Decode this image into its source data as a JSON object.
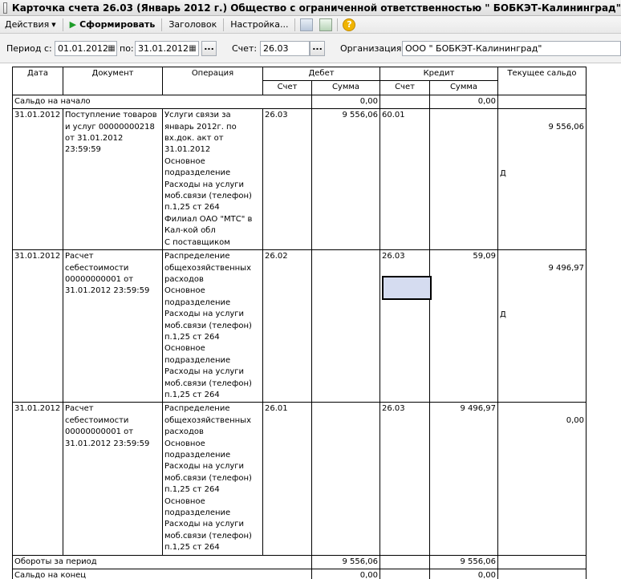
{
  "window": {
    "title": "Карточка счета 26.03 (Январь 2012 г.) Общество с ограниченной ответственностью \" БОБКЭТ-Калининград\""
  },
  "toolbar": {
    "actions_label": "Действия",
    "generate_label": "Сформировать",
    "header_label": "Заголовок",
    "settings_label": "Настройка..."
  },
  "params": {
    "period_from_label": "Период с:",
    "period_from": "01.01.2012",
    "period_to_label": "по:",
    "period_to": "31.01.2012",
    "account_label": "Счет:",
    "account": "26.03",
    "org_label": "Организация:",
    "org": "ООО \" БОБКЭТ-Калининград\"",
    "dots": "..."
  },
  "report": {
    "headers": {
      "date": "Дата",
      "document": "Документ",
      "operation": "Операция",
      "debit": "Дебет",
      "credit": "Кредит",
      "balance": "Текущее сальдо",
      "account": "Счет",
      "sum": "Сумма"
    },
    "opening": {
      "label": "Сальдо на начало",
      "debit_sum": "0,00",
      "credit_sum": "0,00"
    },
    "rows": [
      {
        "date": "31.01.2012",
        "document": "Поступление товаров\nи услуг 00000000218\nот 31.01.2012 23:59:59",
        "operation": "Услуги связи за\nянварь 2012г. по\nвх.док. акт от\n31.01.2012\nОсновное\nподразделение\nРасходы на услуги\nмоб.связи (телефон)\nп.1,25 ст 264\nФилиал ОАО \"МТС\" в\nКал-кой обл\nС поставщиком",
        "debit_account": "26.03",
        "debit_sum": "9 556,06",
        "credit_account": "60.01",
        "credit_sum": "",
        "balance": "9 556,06",
        "balance_side": "Д"
      },
      {
        "date": "31.01.2012",
        "document": "Расчет\nсебестоимости\n00000000001 от\n31.01.2012 23:59:59",
        "operation": "Распределение\nобщехозяйственных\nрасходов\nОсновное\nподразделение\nРасходы на услуги\nмоб.связи (телефон)\nп.1,25 ст 264\nОсновное\nподразделение\nРасходы на услуги\nмоб.связи (телефон)\nп.1,25 ст 264",
        "debit_account": "26.02",
        "debit_sum": "",
        "credit_account": "26.03",
        "credit_sum": "59,09",
        "balance": "9 496,97",
        "balance_side": "Д"
      },
      {
        "date": "31.01.2012",
        "document": "Расчет\nсебестоимости\n00000000001 от\n31.01.2012 23:59:59",
        "operation": "Распределение\nобщехозяйственных\nрасходов\nОсновное\nподразделение\nРасходы на услуги\nмоб.связи (телефон)\nп.1,25 ст 264\nОсновное\nподразделение\nРасходы на услуги\nмоб.связи (телефон)\nп.1,25 ст 264",
        "debit_account": "26.01",
        "debit_sum": "",
        "credit_account": "26.03",
        "credit_sum": "9 496,97",
        "balance": "0,00",
        "balance_side": ""
      }
    ],
    "turnover": {
      "label": "Обороты за период",
      "debit_sum": "9 556,06",
      "credit_sum": "9 556,06"
    },
    "closing": {
      "label": "Сальдо на конец",
      "debit_sum": "0,00",
      "credit_sum": "0,00"
    }
  }
}
